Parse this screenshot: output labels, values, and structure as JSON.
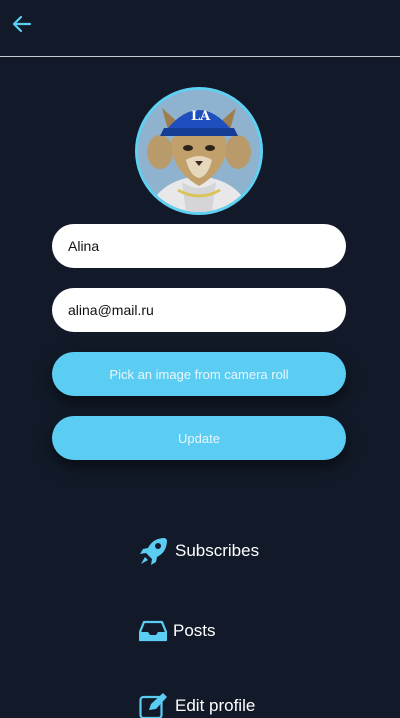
{
  "header": {
    "back_icon": "arrow-left-icon"
  },
  "profile": {
    "avatar_alt": "",
    "name_value": "Alina",
    "email_value": "alina@mail.ru"
  },
  "actions": {
    "pick_image_label": "Pick an image from camera roll",
    "update_label": "Update"
  },
  "menu": {
    "items": [
      {
        "label": "Subscribes",
        "icon": "rocket-icon"
      },
      {
        "label": "Posts",
        "icon": "inbox-icon"
      },
      {
        "label": "Edit profile",
        "icon": "edit-icon"
      }
    ]
  },
  "colors": {
    "background": "#121a29",
    "accent": "#5bcdf3",
    "divider": "#c9ccd2"
  }
}
